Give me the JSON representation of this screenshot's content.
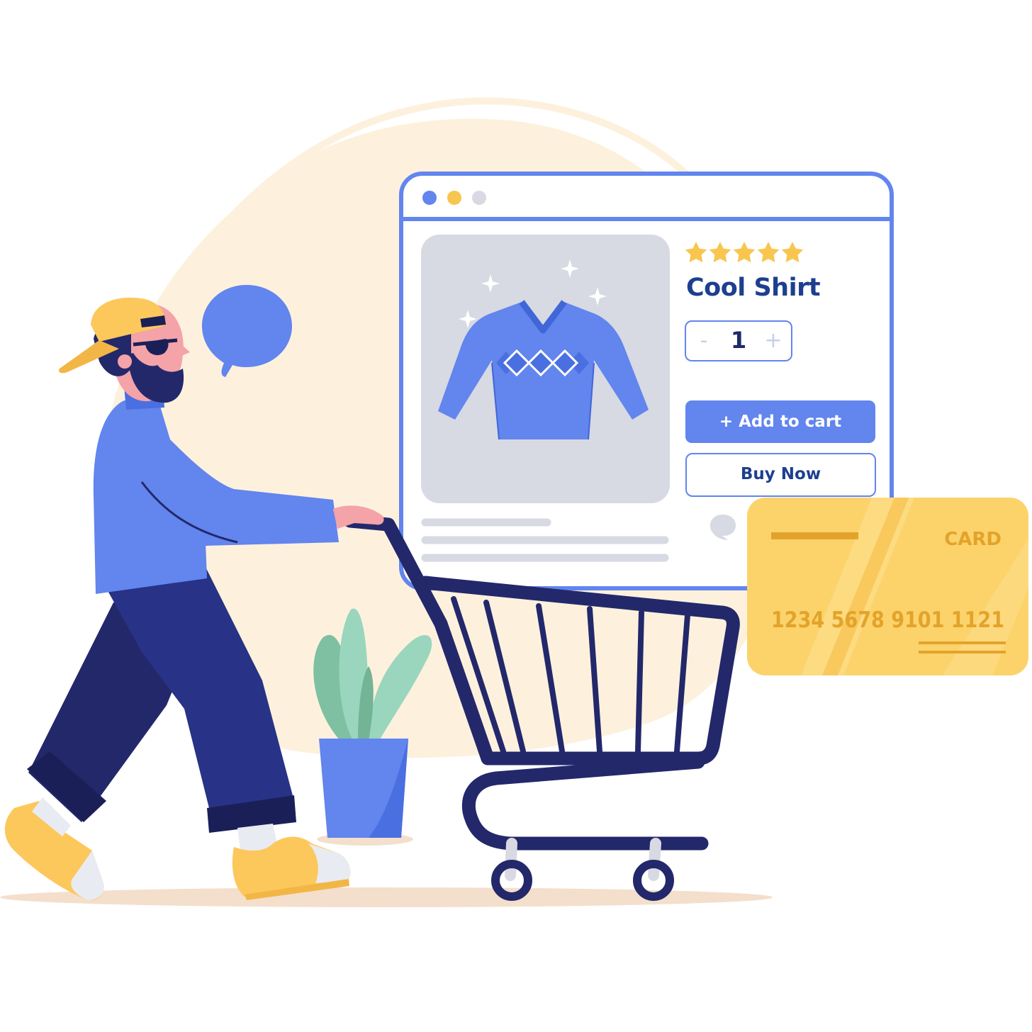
{
  "product": {
    "rating": 5,
    "title": "Cool Shirt",
    "quantity": "1",
    "qty_minus_label": "-",
    "qty_plus_label": "+",
    "add_to_cart_label": "+ Add to cart",
    "buy_now_label": "Buy Now"
  },
  "card": {
    "label": "CARD",
    "number": "1234 5678 9101 1121"
  },
  "colors": {
    "accent_blue": "#6285ee",
    "navy": "#23286b",
    "title_blue": "#1d3f8f",
    "star_yellow": "#f8c64f",
    "card_yellow": "#fcd36b",
    "card_text": "#e3a32a",
    "blob_cream": "#fdf1dd"
  },
  "icons": [
    "speech-bubble-icon",
    "star-icon",
    "sparkle-icon",
    "chat-icon",
    "shopping-cart-icon",
    "sweater-icon"
  ]
}
